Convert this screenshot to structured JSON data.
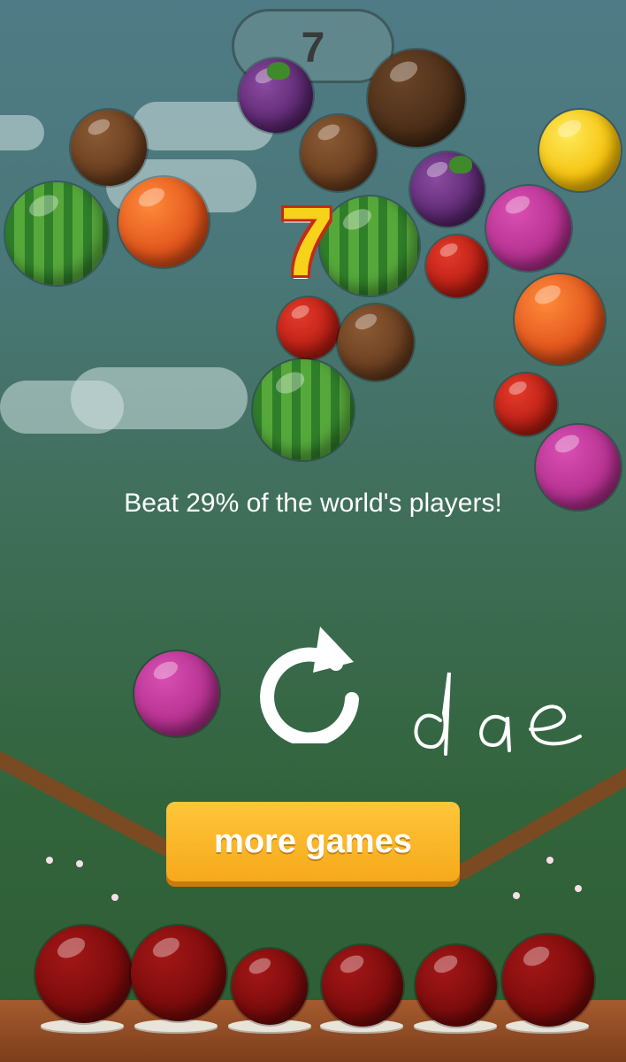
{
  "hud": {
    "score": "7"
  },
  "result": {
    "score": "7",
    "message": "Beat 29% of the world's players!"
  },
  "buttons": {
    "more_games": "more games"
  },
  "handwriting": "dae",
  "icons": {
    "replay": "replay-icon"
  },
  "colors": {
    "button": "#f6a91b",
    "score_fill": "#f7d21a",
    "score_outline": "#c52a17"
  }
}
